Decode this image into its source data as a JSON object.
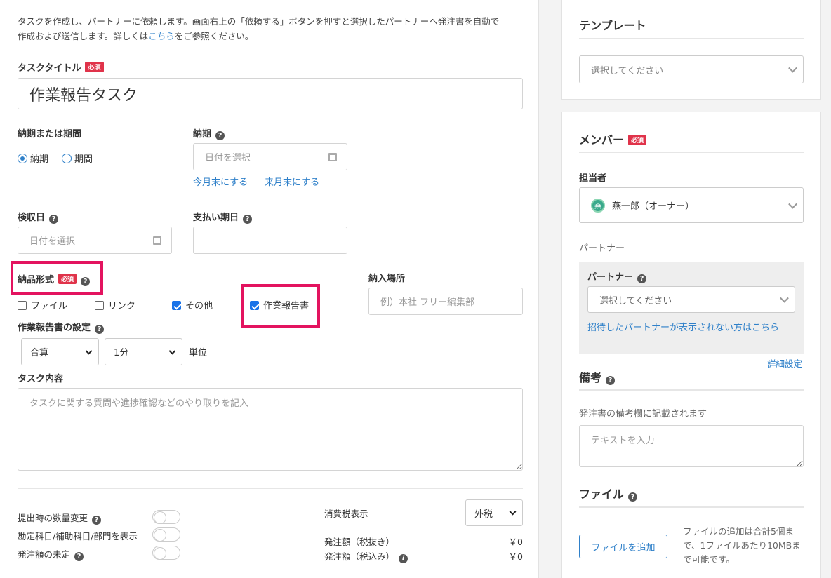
{
  "main": {
    "description_line1": "タスクを作成し、パートナーに依頼します。画面右上の「依頼する」ボタンを押すと選択したパートナーへ発注書を自動で",
    "description_line2_pre": "作成および送信します。詳しくは",
    "description_link": "こちら",
    "description_line2_post": "をご参照ください。",
    "required_badge": "必須",
    "task_title_label": "タスクタイトル",
    "task_title_value": "作業報告タスク",
    "deadline_type_label": "納期または期間",
    "deadline_type_options": [
      "納期",
      "期間"
    ],
    "deadline_label": "納期",
    "date_placeholder": "日付を選択",
    "this_month_end": "今月末にする",
    "next_month_end": "来月末にする",
    "inspection_label": "検収日",
    "payment_label": "支払い期日",
    "delivery_format_label": "納品形式",
    "delivery_formats": [
      "ファイル",
      "リンク",
      "その他",
      "作業報告書"
    ],
    "delivery_place_label": "納入場所",
    "delivery_place_placeholder": "例）本社 フリー編集部",
    "report_setting_label": "作業報告書の設定",
    "report_calc": "合算",
    "report_unit_value": "1分",
    "report_unit_label": "単位",
    "task_content_label": "タスク内容",
    "task_content_placeholder": "タスクに関する質問や進捗確認などのやり取りを記入",
    "toggle_qty": "提出時の数量変更",
    "toggle_accounts": "勘定科目/補助科目/部門を表示",
    "toggle_amount": "発注額の未定",
    "tax_display_label": "消費税表示",
    "tax_display_value": "外税",
    "amount_excl_label": "発注額（税抜き）",
    "amount_excl_value": "￥0",
    "amount_incl_label": "発注額（税込み）",
    "amount_incl_value": "￥0"
  },
  "sidebar": {
    "template_title": "テンプレート",
    "select_placeholder": "選択してください",
    "member_title": "メンバー",
    "assignee_label": "担当者",
    "assignee_avatar": "燕",
    "assignee_name": "燕一郎（オーナー）",
    "partner_section": "パートナー",
    "partner_label": "パートナー",
    "partner_link": "招待したパートナーが表示されない方はこちら",
    "detail_settings": "詳細設定",
    "notes_title": "備考",
    "notes_hint": "発注書の備考欄に記載されます",
    "notes_placeholder": "テキストを入力",
    "file_title": "ファイル",
    "add_file_button": "ファイルを追加",
    "file_note": "ファイルの追加は合計5個まで、1ファイルあたり10MBまで可能です。"
  },
  "colors": {
    "accent": "#2f80c9",
    "required": "#e0334a",
    "highlight": "#e3135f"
  },
  "icons": [
    "help-icon",
    "calendar-icon",
    "chevron-down-icon",
    "info-icon",
    "checkbox-icon",
    "radio-icon"
  ]
}
